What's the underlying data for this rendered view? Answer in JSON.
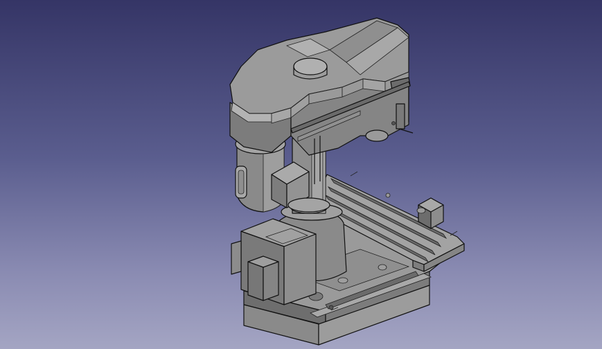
{
  "viewer": {
    "background_top": "#353566",
    "background_bottom": "#a4a5c3",
    "model_color": "#8c8c8c",
    "edge_color": "#111111"
  },
  "model": {
    "parts": [
      "head-housing",
      "head-cap",
      "motor",
      "motor-junction-box",
      "column",
      "base",
      "base-junction-box",
      "xy-table",
      "table-handwheel-motor",
      "table-rails"
    ]
  }
}
